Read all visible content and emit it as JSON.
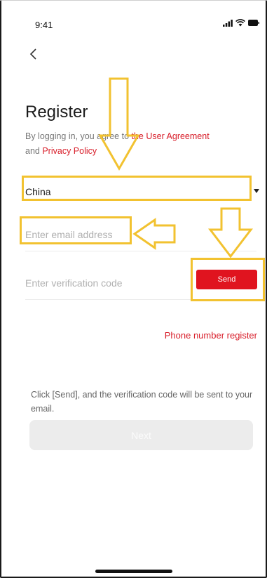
{
  "status_bar": {
    "time": "9:41",
    "icons": [
      "signal-icon",
      "wifi-icon",
      "battery-icon"
    ]
  },
  "header": {
    "back_icon": "chevron-left-icon"
  },
  "page": {
    "title": "Register",
    "agreement_prefix": "By logging in, you agree to ",
    "user_agreement_link": "the User Agreement",
    "agreement_and": " and ",
    "privacy_policy_link": "Privacy Policy"
  },
  "form": {
    "country": "China",
    "email_placeholder": "Enter email address",
    "code_placeholder": "Enter verification code",
    "send_label": "Send",
    "phone_register_label": "Phone number register",
    "hint": "Click [Send], and the verification code will be sent to your email.",
    "next_label": "Next"
  },
  "colors": {
    "accent": "#e0141f",
    "link": "#d81e2a",
    "annotation": "#f2c230",
    "disabled_button": "#ececec"
  }
}
